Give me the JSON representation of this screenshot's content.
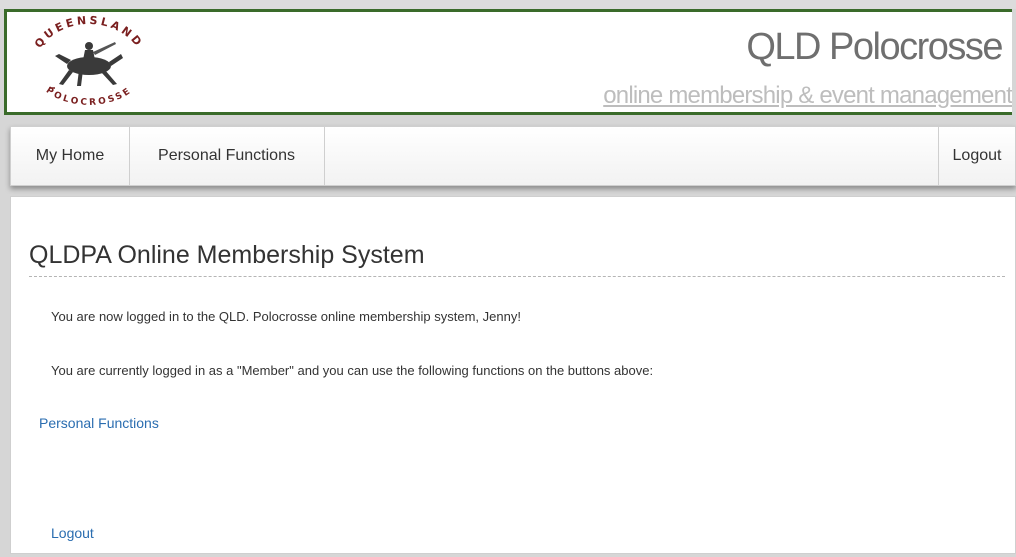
{
  "header": {
    "logo_top_text": "QUEENSLAND",
    "logo_bottom_text": "POLOCROSSE",
    "title": "QLD Polocrosse",
    "subtitle": "online membership & event management"
  },
  "nav": {
    "home": "My Home",
    "personal": "Personal Functions",
    "logout": "Logout"
  },
  "main": {
    "title": "QLDPA Online Membership System",
    "logged_in_message": "You are now logged in to the QLD. Polocrosse online membership system, Jenny!",
    "role_message": "You are currently logged in as a \"Member\" and you can use the following functions on the buttons above:",
    "personal_link": "Personal Functions",
    "logout_link": "Logout"
  },
  "colors": {
    "header_border": "#3a6b2a",
    "link": "#2a6db0",
    "title_gray": "#6f6f6f"
  }
}
